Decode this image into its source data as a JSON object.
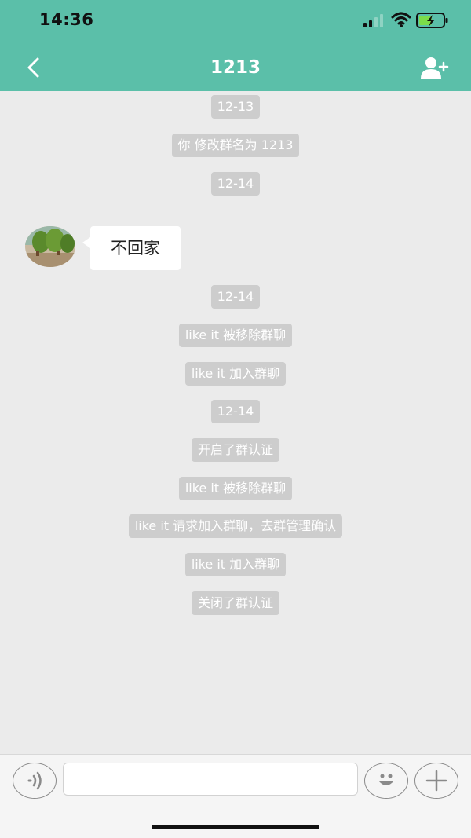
{
  "status_bar": {
    "time": "14:36",
    "icons": [
      "signal-icon",
      "wifi-icon",
      "battery-charging-icon"
    ]
  },
  "nav": {
    "title": "1213",
    "back_icon": "chevron-left-icon",
    "add_icon": "add-member-icon",
    "bar_color": "#5bbfa9"
  },
  "messages": [
    {
      "type": "system",
      "text": "12-13"
    },
    {
      "type": "system",
      "text": "你 修改群名为 1213"
    },
    {
      "type": "system",
      "text": "12-14"
    },
    {
      "type": "incoming",
      "text": "不回家"
    },
    {
      "type": "system",
      "text": "12-14"
    },
    {
      "type": "system",
      "text": "like it 被移除群聊"
    },
    {
      "type": "system",
      "text": "like it 加入群聊"
    },
    {
      "type": "system",
      "text": "12-14"
    },
    {
      "type": "system",
      "text": "开启了群认证"
    },
    {
      "type": "system",
      "text": "like it 被移除群聊"
    },
    {
      "type": "system",
      "text": "like it 请求加入群聊，去群管理确认"
    },
    {
      "type": "system",
      "text": "like it 加入群聊"
    },
    {
      "type": "system",
      "text": "关闭了群认证"
    }
  ],
  "input_bar": {
    "placeholder": "",
    "value": "",
    "icons": [
      "voice-icon",
      "emoji-icon",
      "plus-icon"
    ]
  }
}
